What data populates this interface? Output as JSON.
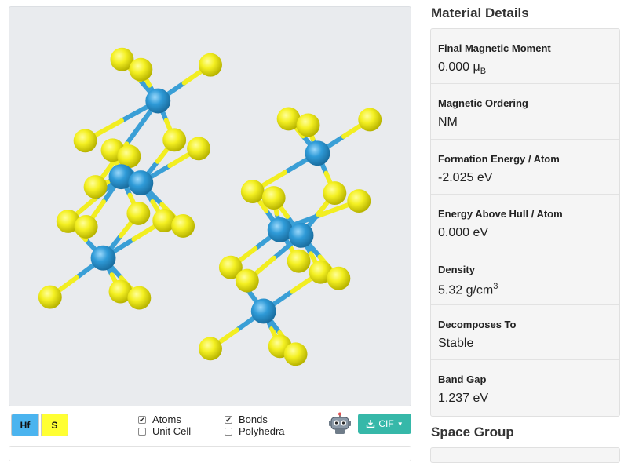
{
  "viewer": {
    "elements": [
      {
        "symbol": "Hf",
        "color": "#4bb4ef"
      },
      {
        "symbol": "S",
        "color": "#ffff33"
      }
    ],
    "options": [
      {
        "label": "Atoms",
        "checked": true
      },
      {
        "label": "Unit Cell",
        "checked": false
      },
      {
        "label": "Bonds",
        "checked": true
      },
      {
        "label": "Polyhedra",
        "checked": false
      }
    ],
    "download_label": "CIF",
    "atom_colors": {
      "hf": "#3a9fd6",
      "s": "#f2ee21"
    }
  },
  "details": {
    "title": "Material Details",
    "rows": [
      {
        "label": "Final Magnetic Moment",
        "value": "0.000 μ",
        "sub": "B"
      },
      {
        "label": "Magnetic Ordering",
        "value": "NM"
      },
      {
        "label": "Formation Energy / Atom",
        "value": "-2.025 eV"
      },
      {
        "label": "Energy Above Hull / Atom",
        "value": "0.000 eV"
      },
      {
        "label": "Density",
        "value": "5.32 g/cm",
        "sup": "3"
      },
      {
        "label": "Decomposes To",
        "value": "Stable"
      },
      {
        "label": "Band Gap",
        "value": "1.237 eV"
      }
    ]
  },
  "space_group": {
    "title": "Space Group"
  }
}
